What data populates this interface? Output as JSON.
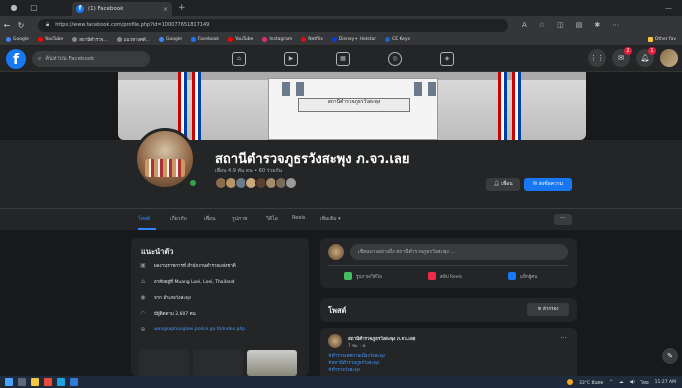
{
  "browser": {
    "tab_title": "(1) Facebook",
    "tab_close": "×",
    "new_tab": "+",
    "url": "https://www.facebook.com/profile.php?id=100077651817149",
    "bookmarks": [
      {
        "label": "Google",
        "color": "#4285f4"
      },
      {
        "label": "YouTube",
        "color": "#ff0000"
      },
      {
        "label": "สถานีตำรวจ...",
        "color": "#888888"
      },
      {
        "label": "แนวทางคดี...",
        "color": "#888888"
      },
      {
        "label": "Google",
        "color": "#4285f4"
      },
      {
        "label": "Facebook",
        "color": "#1877f2"
      },
      {
        "label": "YouTube",
        "color": "#ff0000"
      },
      {
        "label": "Instagram",
        "color": "#e1306c"
      },
      {
        "label": "Netflix",
        "color": "#e50914"
      },
      {
        "label": "Disney+ Hotstar",
        "color": "#113ccf"
      },
      {
        "label": "CE Keys",
        "color": "#1565c0"
      }
    ],
    "other_bookmarks": "Other fav"
  },
  "fb": {
    "logo": "f",
    "search_placeholder": "ค้นหาบน Facebook",
    "accent": "#1877f2",
    "badges": {
      "messenger": "2",
      "notifications": "1"
    }
  },
  "profile": {
    "name": "สถานีตำรวจภูธรวังสะพุง ภ.จว.เลย",
    "stats": "เพื่อน 4.9 พัน คน • 60 ร่วมกัน",
    "follow_label": "เพื่อน",
    "message_label": "ส่งข้อความ",
    "cover_sign": "สถานีตำรวจภูธรวังสะพุง"
  },
  "tabs": [
    {
      "label": "โพสต์",
      "active": true
    },
    {
      "label": "เกี่ยวกับ",
      "active": false
    },
    {
      "label": "เพื่อน",
      "active": false
    },
    {
      "label": "รูปภาพ",
      "active": false
    },
    {
      "label": "วิดีโอ",
      "active": false
    },
    {
      "label": "Reels",
      "active": false
    },
    {
      "label": "เพิ่มเติม ▾",
      "active": false
    }
  ],
  "tabs_more": "···",
  "intro": {
    "title": "แนะนำตัว",
    "rows": [
      {
        "icon": "briefcase-icon",
        "glyph": "▣",
        "text": "ผลงานราชการที่ สำนักงานตำรวจแห่งชาติ"
      },
      {
        "icon": "home-icon",
        "glyph": "⌂",
        "text": "อาศัยอยู่ที่ Muang Loei, Loei, Thailand"
      },
      {
        "icon": "location-icon",
        "glyph": "◉",
        "text": "จาก อำเภอวังสะพุง"
      },
      {
        "icon": "rss-icon",
        "glyph": "◠",
        "text": "มีผู้ติดตาม 2,607 คน"
      },
      {
        "icon": "globe-icon",
        "glyph": "⊕",
        "text": "wangsaphungloei.police.go.th/index.php"
      }
    ]
  },
  "composer": {
    "placeholder": "เขียนบางอย่างถึง สถานีตำรวจภูธรวังสะพุง ...",
    "actions": [
      {
        "label": "รูปภาพ/วิดีโอ",
        "color": "#45bd62"
      },
      {
        "label": "คลิป Reels",
        "color": "#f02849"
      },
      {
        "label": "แท็กผู้คน",
        "color": "#1877f2"
      }
    ]
  },
  "posts": {
    "title": "โพสต์",
    "filter_label": "ตัวกรอง"
  },
  "post": {
    "author": "สถานีตำรวจภูธรวังสะพุง ภ.จว.เลย",
    "time": "7 ชม. · ⊕",
    "more": "···",
    "tags": [
      "#ตำรวจเทศบาลเมืองวังสะพุง",
      "#สถานีตำรวจภูธรวังสะพุง",
      "#ตำรวจวังสะพุง"
    ]
  },
  "taskbar": {
    "weather": "33°C มีแดด",
    "lang": "ไทย",
    "time": "11:27 AM"
  }
}
